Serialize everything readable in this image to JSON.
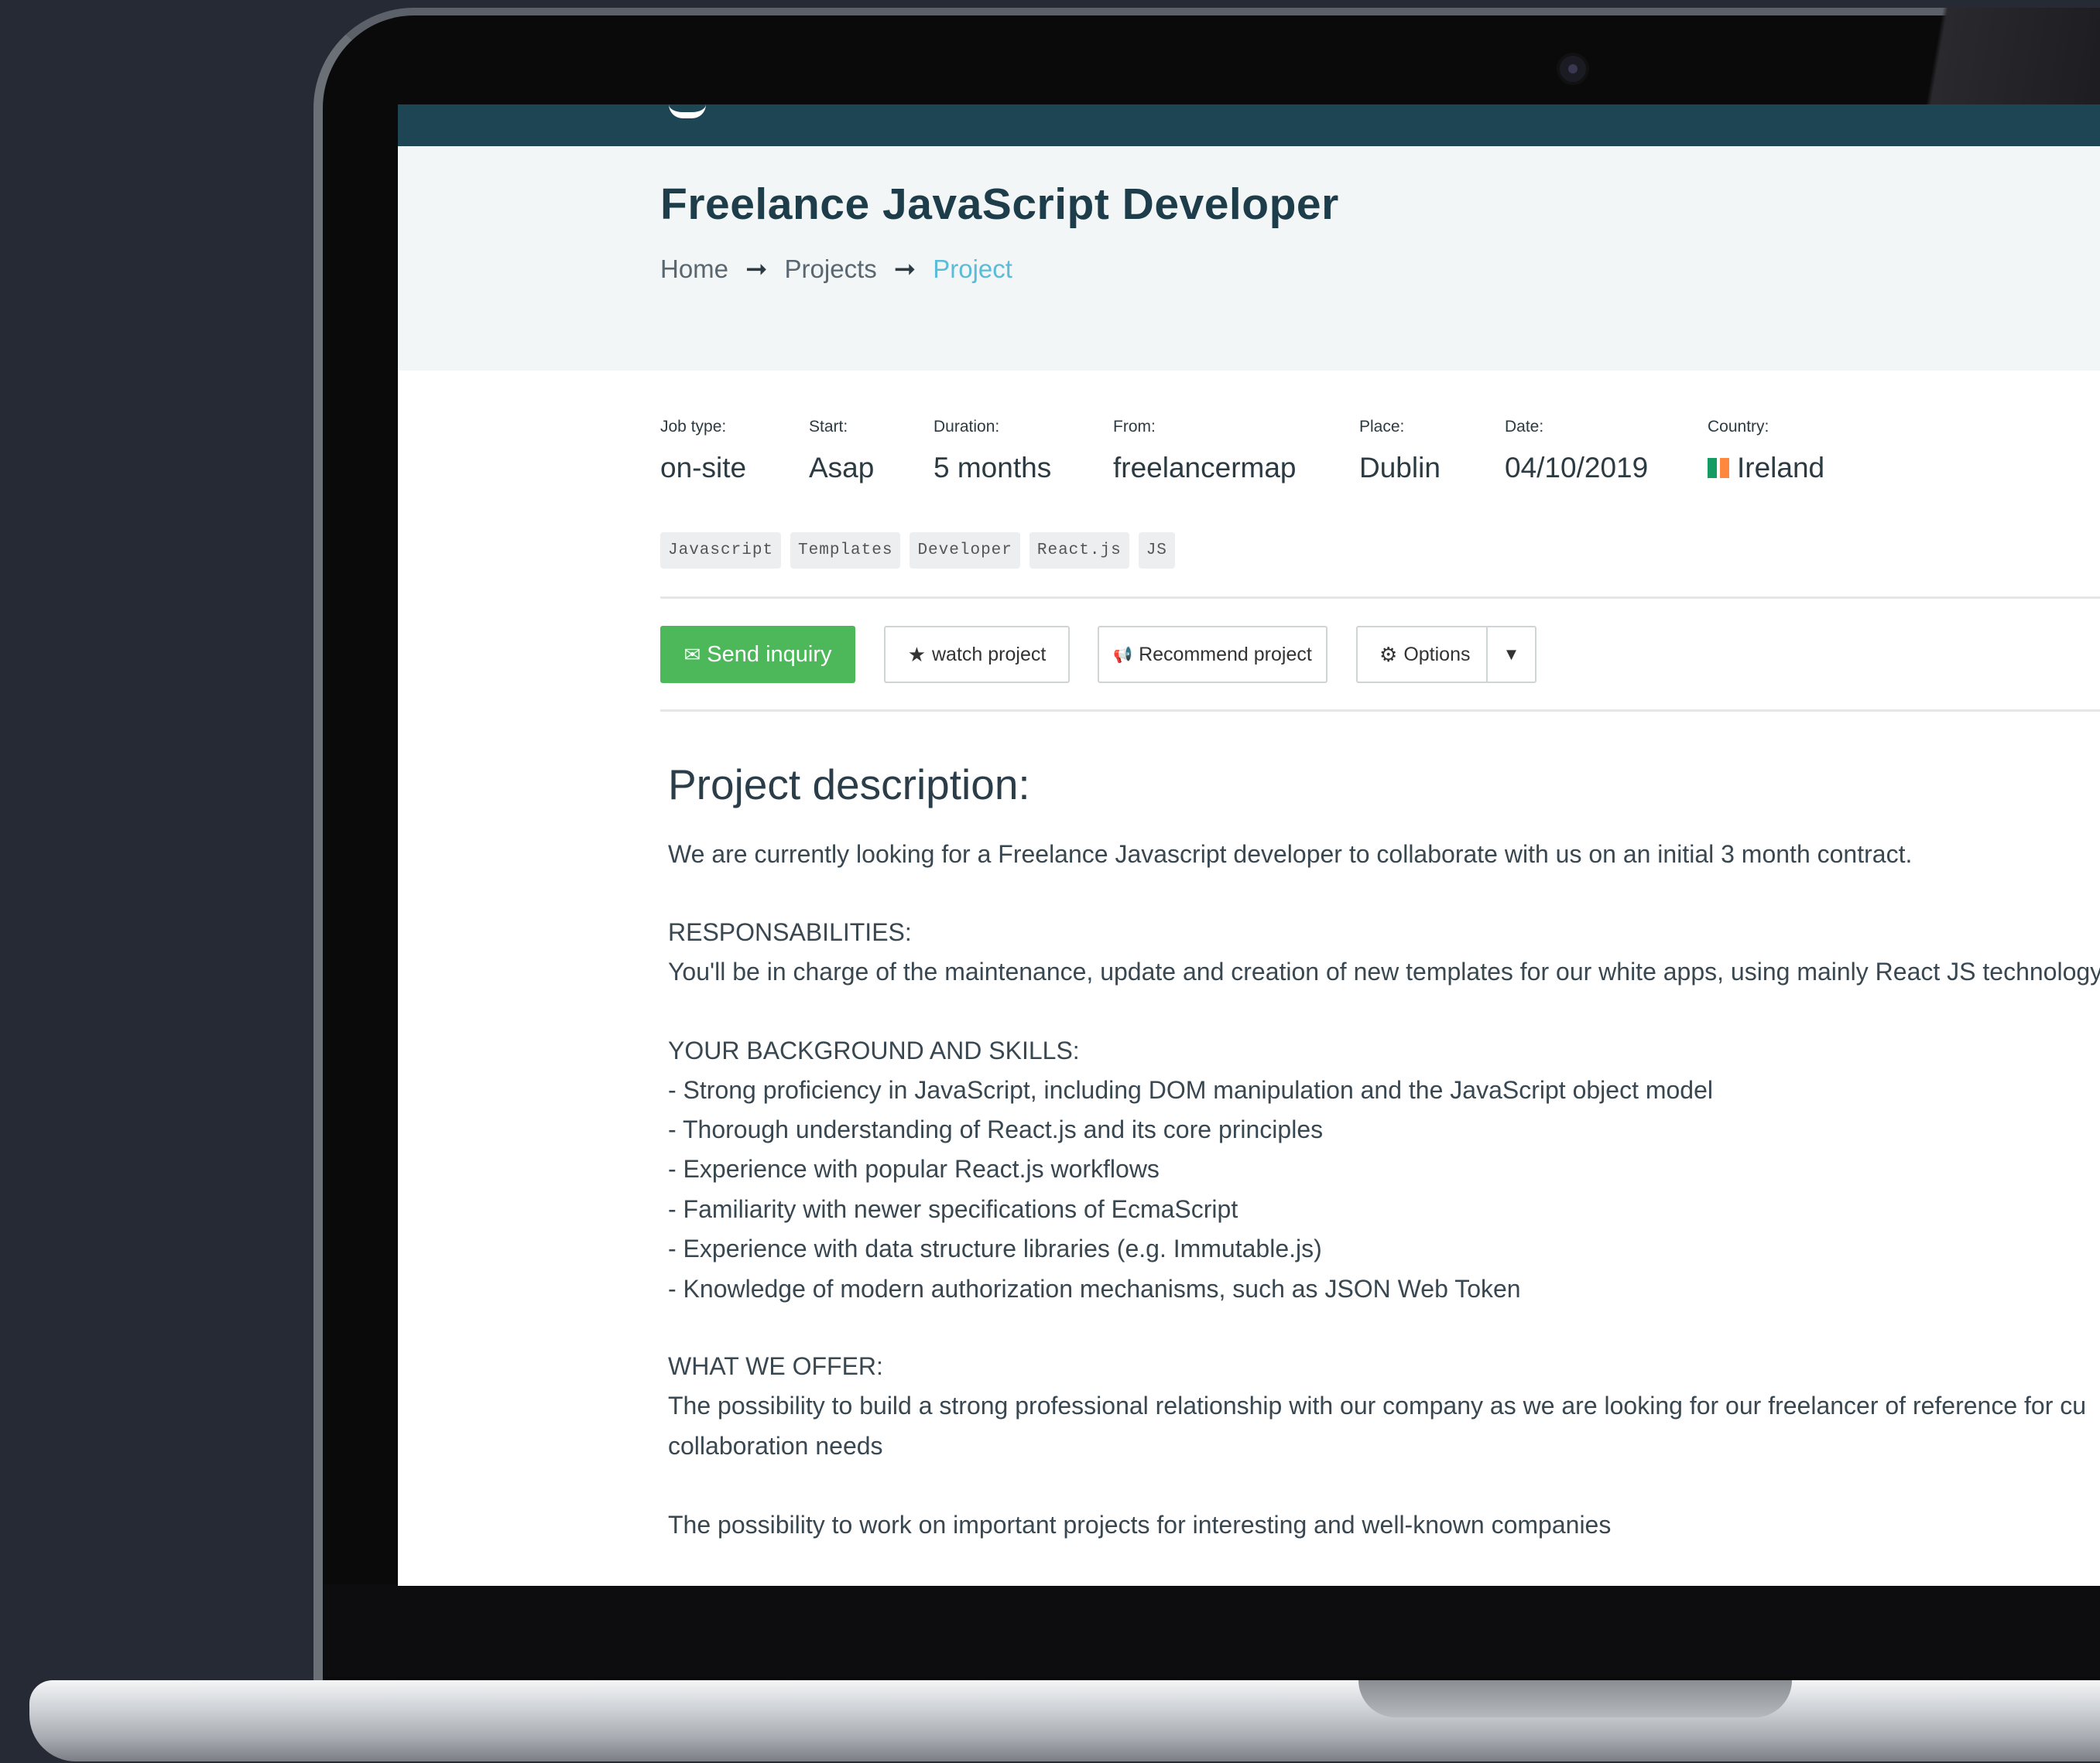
{
  "page": {
    "title": "Freelance JavaScript Developer",
    "breadcrumb": {
      "home": "Home",
      "projects": "Projects",
      "current": "Project"
    }
  },
  "meta": [
    {
      "label": "Job type:",
      "value": "on-site"
    },
    {
      "label": "Start:",
      "value": "Asap"
    },
    {
      "label": "Duration:",
      "value": "5 months"
    },
    {
      "label": "From:",
      "value": "freelancermap"
    },
    {
      "label": "Place:",
      "value": "Dublin"
    },
    {
      "label": "Date:",
      "value": "04/10/2019"
    },
    {
      "label": "Country:",
      "value": "Ireland"
    }
  ],
  "flag_colors": [
    "#169b62",
    "#ff883e"
  ],
  "tags": [
    "Javascript",
    "Templates",
    "Developer",
    "React.js",
    "JS"
  ],
  "actions": {
    "send_inquiry": "Send inquiry",
    "watch_project": "watch project",
    "recommend_project": "Recommend project",
    "options": "Options"
  },
  "icons": {
    "envelope": "✉",
    "star": "★",
    "megaphone": "📢",
    "gear": "⚙",
    "caret": "▼"
  },
  "colors": {
    "navbar": "#1e4554",
    "title": "#1e3d4a",
    "primary_button": "#4cb85a",
    "breadcrumb_active": "#5bbbd8"
  },
  "description": {
    "heading": "Project description:",
    "lines": [
      "We are currently looking for a Freelance Javascript developer to collaborate with us on an initial 3 month contract.",
      "RESPONSABILITIES:",
      "You'll be in charge of the maintenance, update and creation of new templates for our white apps, using mainly React JS technology",
      "YOUR BACKGROUND AND SKILLS:",
      "- Strong proficiency in JavaScript, including DOM manipulation and the JavaScript object model",
      "- Thorough understanding of React.js and its core principles",
      "- Experience with popular React.js workflows",
      "- Familiarity with newer specifications of EcmaScript",
      "- Experience with data structure libraries (e.g. Immutable.js)",
      "- Knowledge of modern authorization mechanisms, such as JSON Web Token",
      "WHAT WE OFFER:",
      "The possibility to build a strong professional relationship with our company as we are looking for our freelancer of reference for cu",
      "collaboration needs",
      "The possibility to work on important projects for interesting and well-known companies"
    ]
  }
}
